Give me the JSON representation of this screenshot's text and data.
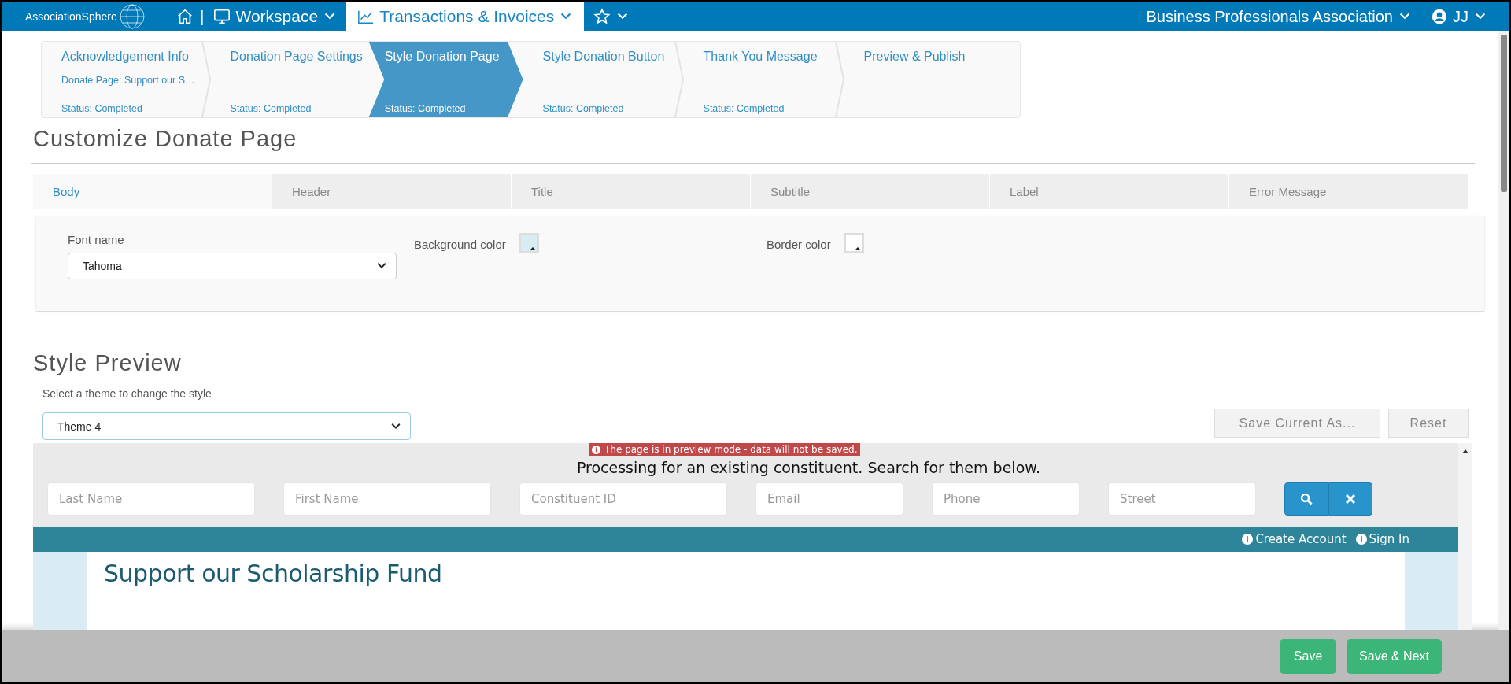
{
  "nav": {
    "logo": "AssociationSphere",
    "separator": "|",
    "items": [
      {
        "kind": "home",
        "selected": false
      },
      {
        "kind": "menu",
        "label": "Workspace",
        "selected": false
      },
      {
        "kind": "menu",
        "label": "Transactions & Invoices",
        "selected": true
      },
      {
        "kind": "star",
        "selected": false
      }
    ],
    "organization": "Business Professionals Association",
    "user": "JJ"
  },
  "steps": [
    {
      "title": "Acknowledgement Info",
      "detail": "Donate Page: Support our S…",
      "status": "Status: Completed",
      "selected": false
    },
    {
      "title": "Donation Page Settings",
      "status": "Status: Completed",
      "selected": false
    },
    {
      "title": "Style Donation Page",
      "status": "Status: Completed",
      "selected": true
    },
    {
      "title": "Style Donation Button",
      "status": "Status: Completed",
      "selected": false
    },
    {
      "title": "Thank You Message",
      "status": "Status: Completed",
      "selected": false
    },
    {
      "title": "Preview & Publish",
      "selected": false
    }
  ],
  "customize": {
    "heading": "Customize Donate Page",
    "tabs": [
      {
        "label": "Body",
        "selected": true
      },
      {
        "label": "Header",
        "selected": false
      },
      {
        "label": "Title",
        "selected": false
      },
      {
        "label": "Subtitle",
        "selected": false
      },
      {
        "label": "Label",
        "selected": false
      },
      {
        "label": "Error Message",
        "selected": false
      }
    ],
    "font_name": {
      "label": "Font name",
      "value": "Tahoma"
    },
    "background_color": {
      "label": "Background color",
      "color": "#d9ecf4"
    },
    "border_color": {
      "label": "Border color",
      "color": "#ffffff"
    }
  },
  "style_preview": {
    "heading": "Style Preview",
    "theme_label": "Select a theme to change the style",
    "theme": "Theme 4",
    "buttons": [
      "Save Current As...",
      "Reset"
    ],
    "banner": "The page is in preview mode - data will not be saved.",
    "intro": "Processing for an existing constituent. Search for them below.",
    "search_fields": [
      {
        "placeholder": "Last Name"
      },
      {
        "placeholder": "First Name"
      },
      {
        "placeholder": "Constituent ID"
      },
      {
        "placeholder": "Email"
      },
      {
        "placeholder": "Phone"
      },
      {
        "placeholder": "Street"
      }
    ],
    "links": [
      "Create Account",
      "Sign In"
    ],
    "page_title": "Support our Scholarship Fund"
  },
  "footer": {
    "buttons": [
      "Save",
      "Save & Next"
    ]
  }
}
